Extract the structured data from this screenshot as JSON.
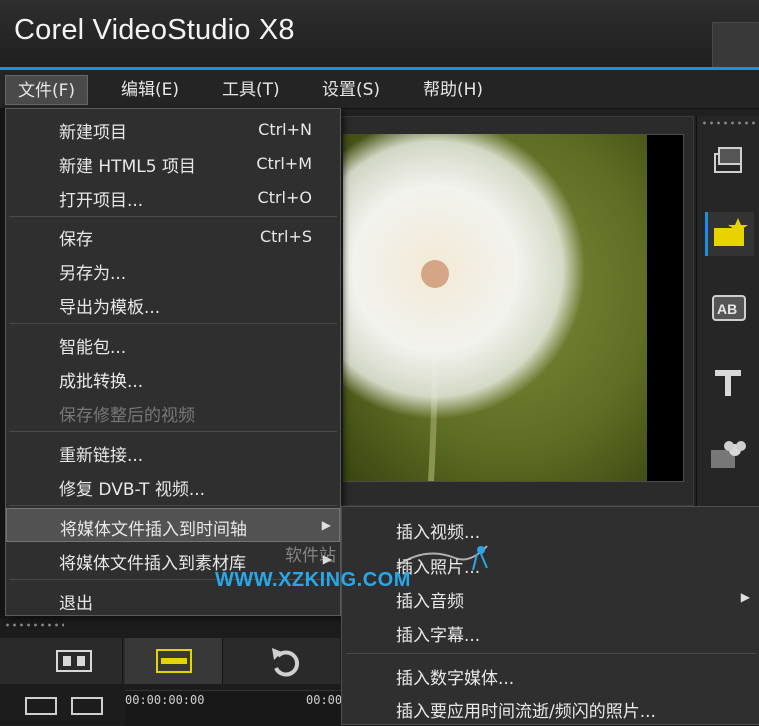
{
  "app": {
    "title": "Corel VideoStudio X8"
  },
  "menubar": {
    "file": "文件(F)",
    "edit": "编辑(E)",
    "tools": "工具(T)",
    "settings": "设置(S)",
    "help": "帮助(H)"
  },
  "file_menu": {
    "new_project": {
      "label": "新建项目",
      "shortcut": "Ctrl+N"
    },
    "new_html5_project": {
      "label": "新建 HTML5 项目",
      "shortcut": "Ctrl+M"
    },
    "open_project": {
      "label": "打开项目...",
      "shortcut": "Ctrl+O"
    },
    "save": {
      "label": "保存",
      "shortcut": "Ctrl+S"
    },
    "save_as": {
      "label": "另存为..."
    },
    "export_template": {
      "label": "导出为模板..."
    },
    "smart_package": {
      "label": "智能包..."
    },
    "batch_convert": {
      "label": "成批转换..."
    },
    "save_trimmed": {
      "label": "保存修整后的视频"
    },
    "relink": {
      "label": "重新链接..."
    },
    "repair_dvbt": {
      "label": "修复 DVB-T 视频..."
    },
    "insert_to_timeline": {
      "label": "将媒体文件插入到时间轴"
    },
    "insert_to_library": {
      "label": "将媒体文件插入到素材库"
    },
    "exit": {
      "label": "退出"
    }
  },
  "submenu": {
    "insert_video": "插入视频...",
    "insert_photo": "插入照片...",
    "insert_audio": "插入音频",
    "insert_subtitle": "插入字幕...",
    "insert_digital_media": "插入数字媒体...",
    "insert_timelapse": "插入要应用时间流逝/频闪的照片..."
  },
  "timeline": {
    "timecode_start": "00:00:00:00",
    "timecode_next": "00:00"
  },
  "watermark": {
    "site_name": "软件站",
    "url": "WWW.XZKING.COM"
  },
  "icons": {
    "media": "media-icon",
    "instant_project": "instant-project-icon",
    "transition": "transition-icon",
    "title": "title-icon",
    "graphic": "graphic-icon",
    "storyboard": "storyboard-view-icon",
    "timeline_view": "timeline-view-icon",
    "undo": "undo-icon"
  },
  "colors": {
    "accent": "#1e8fe0",
    "highlight_yellow": "#e6d300"
  }
}
